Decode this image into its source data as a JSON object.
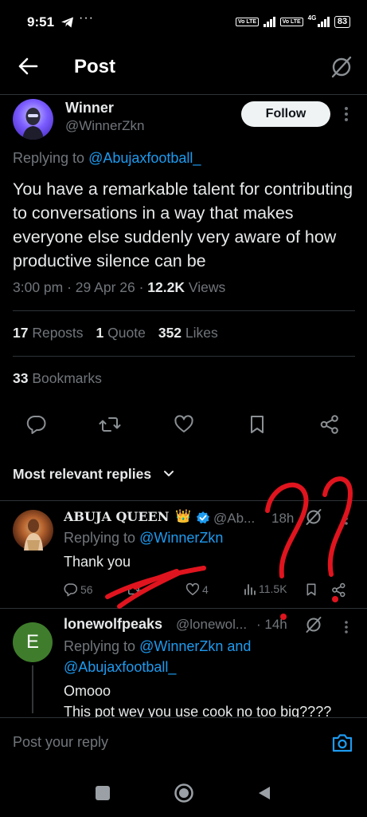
{
  "status_bar": {
    "time": "9:51",
    "dots": "···",
    "volte_1": "Vo LTE",
    "volte_2": "Vo LTE",
    "network": "4G",
    "battery": "83"
  },
  "header": {
    "title": "Post"
  },
  "post": {
    "author_name": "Winner",
    "author_handle": "@WinnerZkn",
    "follow_label": "Follow",
    "replying_prefix": "Replying to",
    "replying_to": "@Abujaxfootball_",
    "text": "You have a remarkable talent for contributing to conversations in a way that makes everyone else suddenly very aware of how productive silence can be",
    "time": "3:00 pm",
    "date": "29 Apr 26",
    "views_count": "12.2K",
    "views_label": "Views",
    "reposts_count": "17",
    "reposts_label": "Reposts",
    "quotes_count": "1",
    "quotes_label": "Quote",
    "likes_count": "352",
    "likes_label": "Likes",
    "bookmarks_count": "33",
    "bookmarks_label": "Bookmarks"
  },
  "replies_sort": {
    "label": "Most relevant replies"
  },
  "replies": [
    {
      "name": "ABUJA QUEEN",
      "crown": "👑",
      "handle": "@Ab...",
      "time": "18h",
      "replying_prefix": "Replying to",
      "replying_to": "@WinnerZkn",
      "text": "Thank you",
      "reply_count": "56",
      "like_count": "4",
      "view_count": "11.5K"
    },
    {
      "avatar_letter": "E",
      "name": "lonewolfpeaks",
      "handle": "@lonewol...",
      "time": "· 14h",
      "replying_line_1_prefix": "Replying to",
      "replying_line_1": "@WinnerZkn and",
      "replying_line_2": "@Abujaxfootball_",
      "text_1": "Omooo",
      "text_2": "This pot wey you use cook no too big????"
    }
  ],
  "compose": {
    "placeholder": "Post your reply"
  },
  "colors": {
    "background": "#000000",
    "accent": "#1d9bf0",
    "muted_text": "#71767b",
    "annotation_red": "#e0141e"
  }
}
